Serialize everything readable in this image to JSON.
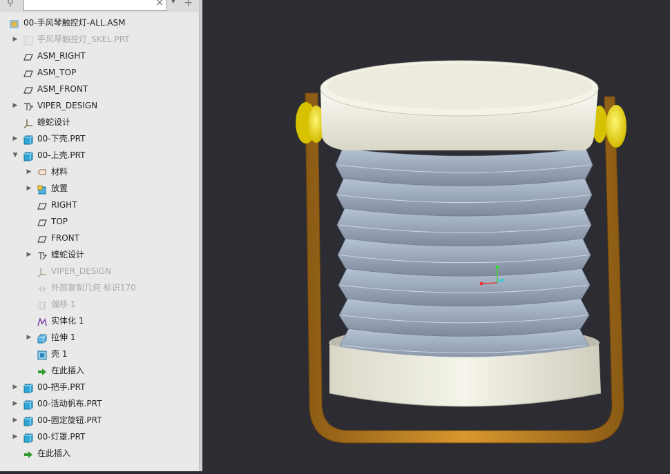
{
  "search": {
    "value": "",
    "clear": "×"
  },
  "tree": [
    {
      "label": "00-手风琴触控灯-ALL.ASM",
      "icon": "assembly-icon",
      "level": 0,
      "expander": "none",
      "dim": false
    },
    {
      "label": "手风琴触控灯_SKEL.PRT",
      "icon": "skeleton-part-icon",
      "level": 1,
      "expander": "collapsed",
      "dim": true
    },
    {
      "label": "ASM_RIGHT",
      "icon": "datum-plane-icon",
      "level": 1,
      "expander": "none",
      "dim": false
    },
    {
      "label": "ASM_TOP",
      "icon": "datum-plane-icon",
      "level": 1,
      "expander": "none",
      "dim": false
    },
    {
      "label": "ASM_FRONT",
      "icon": "datum-plane-icon",
      "level": 1,
      "expander": "none",
      "dim": false
    },
    {
      "label": "VIPER_DESIGN",
      "icon": "design-feature-icon",
      "level": 1,
      "expander": "collapsed",
      "dim": false
    },
    {
      "label": "蝰蛇设计",
      "icon": "coordinate-system-icon",
      "level": 1,
      "expander": "none",
      "dim": false
    },
    {
      "label": "00-下壳.PRT",
      "icon": "part-icon",
      "level": 1,
      "expander": "collapsed",
      "dim": false
    },
    {
      "label": "00-上壳.PRT",
      "icon": "part-icon",
      "level": 1,
      "expander": "expanded",
      "dim": false
    },
    {
      "label": "材料",
      "icon": "material-icon",
      "level": 2,
      "expander": "collapsed",
      "dim": false
    },
    {
      "label": "放置",
      "icon": "placement-icon",
      "level": 2,
      "expander": "collapsed",
      "dim": false
    },
    {
      "label": "RIGHT",
      "icon": "datum-plane-icon",
      "level": 2,
      "expander": "none",
      "dim": false
    },
    {
      "label": "TOP",
      "icon": "datum-plane-icon",
      "level": 2,
      "expander": "none",
      "dim": false
    },
    {
      "label": "FRONT",
      "icon": "datum-plane-icon",
      "level": 2,
      "expander": "none",
      "dim": false
    },
    {
      "label": "蝰蛇设计",
      "icon": "design-feature-icon",
      "level": 2,
      "expander": "collapsed",
      "dim": false
    },
    {
      "label": "VIPER_DESIGN",
      "icon": "coordinate-system-icon",
      "level": 2,
      "expander": "none",
      "dim": true
    },
    {
      "label": "外部复制几何 标识170",
      "icon": "external-copy-geometry-icon",
      "level": 2,
      "expander": "none",
      "dim": true
    },
    {
      "label": "偏移 1",
      "icon": "offset-icon",
      "level": 2,
      "expander": "none",
      "dim": true
    },
    {
      "label": "实体化 1",
      "icon": "solidify-icon",
      "level": 2,
      "expander": "none",
      "dim": false
    },
    {
      "label": "拉伸 1",
      "icon": "extrude-icon",
      "level": 2,
      "expander": "collapsed",
      "dim": false
    },
    {
      "label": "壳 1",
      "icon": "shell-icon",
      "level": 2,
      "expander": "none",
      "dim": false
    },
    {
      "label": "在此插入",
      "icon": "insert-here-arrow-icon",
      "level": 2,
      "expander": "none",
      "dim": false
    },
    {
      "label": "00-把手.PRT",
      "icon": "part-icon",
      "level": 1,
      "expander": "collapsed",
      "dim": false
    },
    {
      "label": "00-活动帆布.PRT",
      "icon": "part-icon",
      "level": 1,
      "expander": "collapsed",
      "dim": false
    },
    {
      "label": "00-固定旋钮.PRT",
      "icon": "part-icon",
      "level": 1,
      "expander": "collapsed",
      "dim": false
    },
    {
      "label": "00-灯罩.PRT",
      "icon": "part-icon",
      "level": 1,
      "expander": "collapsed",
      "dim": false
    },
    {
      "label": "在此插入",
      "icon": "insert-here-arrow-icon",
      "level": 1,
      "expander": "none",
      "dim": false
    }
  ],
  "colors": {
    "panel_bg": "#e9e9e9",
    "viewport_bg": "#2c2c32",
    "handle": "#c88a2a",
    "knob": "#f0e21a",
    "cap": "#f0efe3",
    "bellows": "#a4b2c6"
  }
}
